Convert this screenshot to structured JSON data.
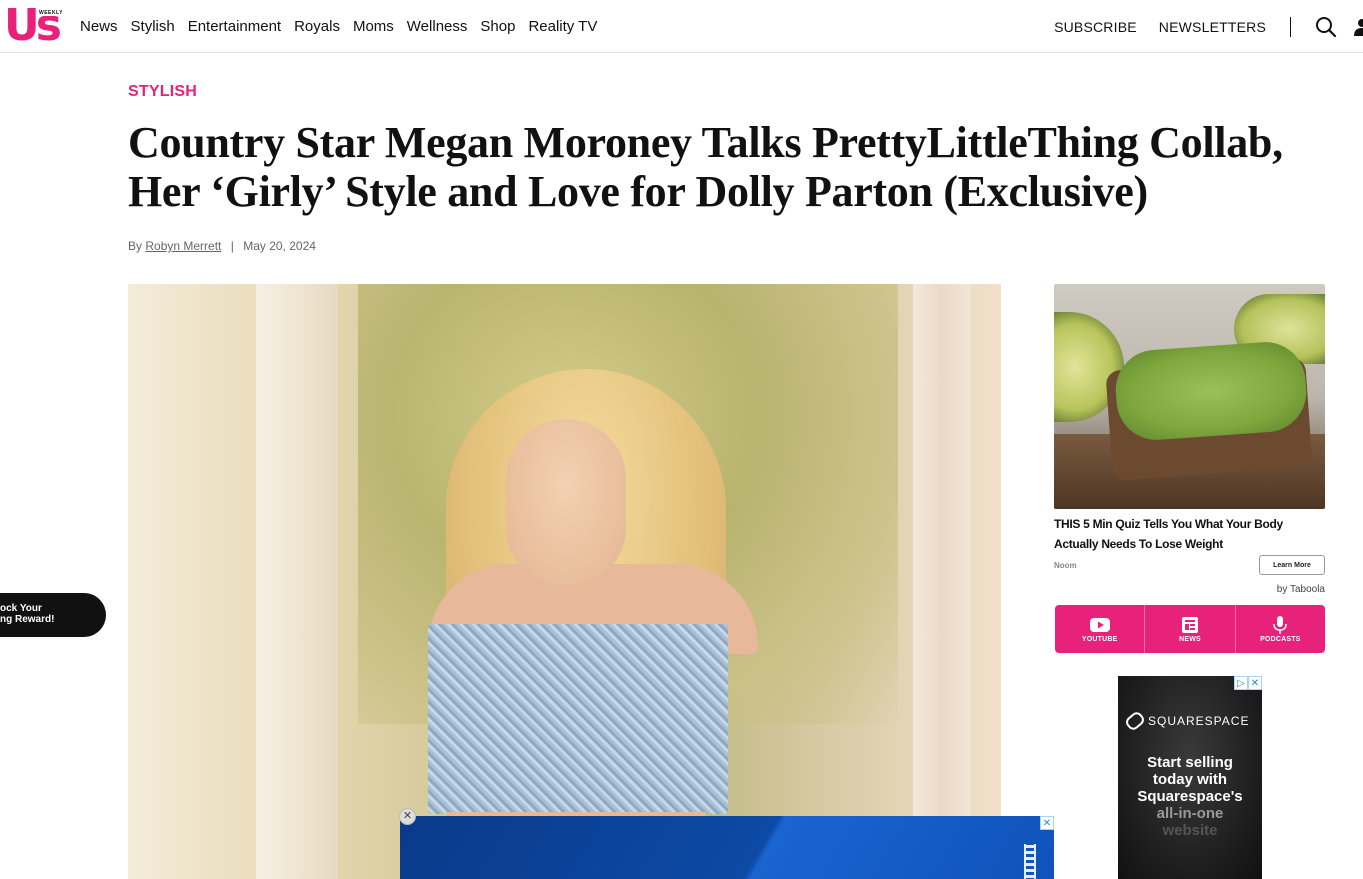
{
  "nav": {
    "logo_text": "Us",
    "logo_small": "WEEKLY",
    "links": [
      "News",
      "Stylish",
      "Entertainment",
      "Royals",
      "Moms",
      "Wellness",
      "Shop",
      "Reality TV"
    ],
    "subscribe": "SUBSCRIBE",
    "newsletters": "NEWSLETTERS"
  },
  "article": {
    "category": "STYLISH",
    "headline": "Country Star Megan Moroney Talks PrettyLittleThing Collab, Her ‘Girly’ Style and Love for Dolly Parton (Exclusive)",
    "by": "By",
    "author": "Robyn Merrett",
    "separator": "|",
    "date": "May 20, 2024"
  },
  "reward": {
    "line1": "ock Your",
    "line2": "ng Reward!"
  },
  "sidebar_ad": {
    "title": "THIS 5 Min Quiz Tells You What Your Body Actually Needs To Lose Weight",
    "brand": "Noom",
    "cta": "Learn More",
    "provider": "by Taboola"
  },
  "social": {
    "items": [
      "YOUTUBE",
      "NEWS",
      "PODCASTS"
    ]
  },
  "squarespace_ad": {
    "badge_ad": "▷",
    "badge_close": "✕",
    "brand": "SQUARESPACE",
    "line1": "Start selling",
    "line2": "today with",
    "line3": "Squarespace's",
    "line4": "all-in-one",
    "line5": "website"
  },
  "bottom_ad": {
    "close": "✕",
    "dismiss": "✕"
  },
  "colors": {
    "brand_pink": "#e8217a",
    "text": "#111111"
  }
}
